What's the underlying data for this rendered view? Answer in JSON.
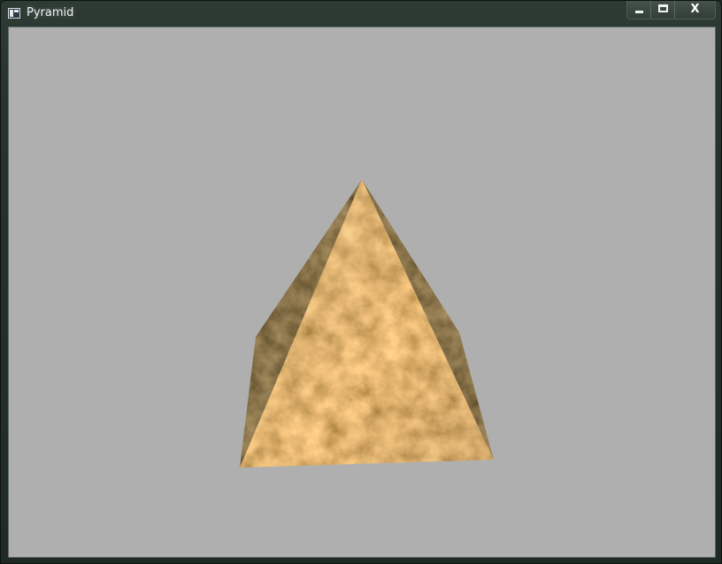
{
  "window": {
    "title": "Pyramid",
    "frame_color": "#26332d",
    "client_background": "#afafaf"
  },
  "caption_buttons": {
    "minimize_icon": "minimize-icon",
    "maximize_icon": "maximize-icon",
    "close_label": "X"
  },
  "scene": {
    "object": "textured-pyramid",
    "front_face_color": "#c98a4a",
    "side_face_color": "#3a2a18"
  }
}
